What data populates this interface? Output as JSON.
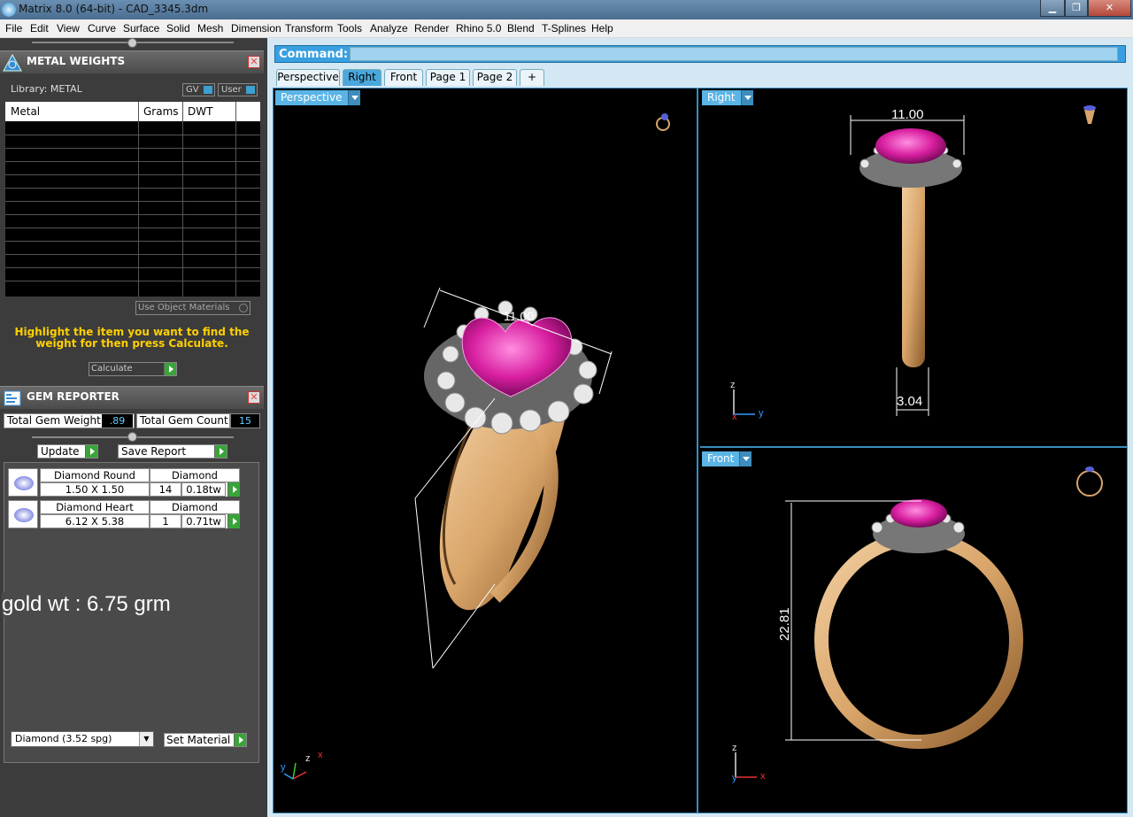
{
  "window": {
    "title": "Matrix 8.0 (64-bit) - CAD_3345.3dm",
    "min": "▁",
    "max": "❐",
    "close": "✕"
  },
  "menu": [
    "File",
    "Edit",
    "View",
    "Curve",
    "Surface",
    "Solid",
    "Mesh",
    "Dimension",
    "Transform",
    "Tools",
    "Analyze",
    "Render",
    "Rhino 5.0",
    "Blend",
    "T-Splines",
    "Help"
  ],
  "metal_panel": {
    "title": "METAL WEIGHTS",
    "library_label": "Library: METAL",
    "toggle_gv": "GV",
    "toggle_user": "User",
    "columns": [
      "Metal",
      "Grams",
      "DWT"
    ],
    "use_object_materials": "Use Object Materials",
    "hint": "Highlight the item you want to find the weight for then press Calculate.",
    "calculate": "Calculate"
  },
  "gem_panel": {
    "title": "GEM REPORTER",
    "total_weight_label": "Total Gem Weight",
    "total_weight_value": ".89",
    "total_count_label": "Total Gem Count",
    "total_count_value": "15",
    "update": "Update",
    "save_report": "Save Report",
    "gems": [
      {
        "shape": "Diamond Round",
        "material": "Diamond",
        "size": "1.50 X 1.50",
        "count": "14",
        "weight": "0.18tw"
      },
      {
        "shape": "Diamond Heart",
        "material": "Diamond",
        "size": "6.12 X 5.38",
        "count": "1",
        "weight": "0.71tw"
      }
    ],
    "note": "gold wt : 6.75 grm",
    "material_select": "Diamond     (3.52 spg)",
    "set_material": "Set Material"
  },
  "command": {
    "label": "Command:"
  },
  "tabs": [
    "Perspective",
    "Right",
    "Front",
    "Page 1",
    "Page 2",
    "+"
  ],
  "viewports": {
    "perspective": {
      "label": "Perspective",
      "dim1": "11.00"
    },
    "right": {
      "label": "Right",
      "dim_width": "11.00",
      "dim_shank": "3.04"
    },
    "front": {
      "label": "Front",
      "dim_height": "22.81"
    }
  },
  "axes": {
    "x": "x",
    "y": "y",
    "z": "z"
  },
  "colors": {
    "accent": "#38a0e0",
    "hint": "#ffd000",
    "gem": "#d81fa0",
    "gold": "#d9a56a"
  }
}
